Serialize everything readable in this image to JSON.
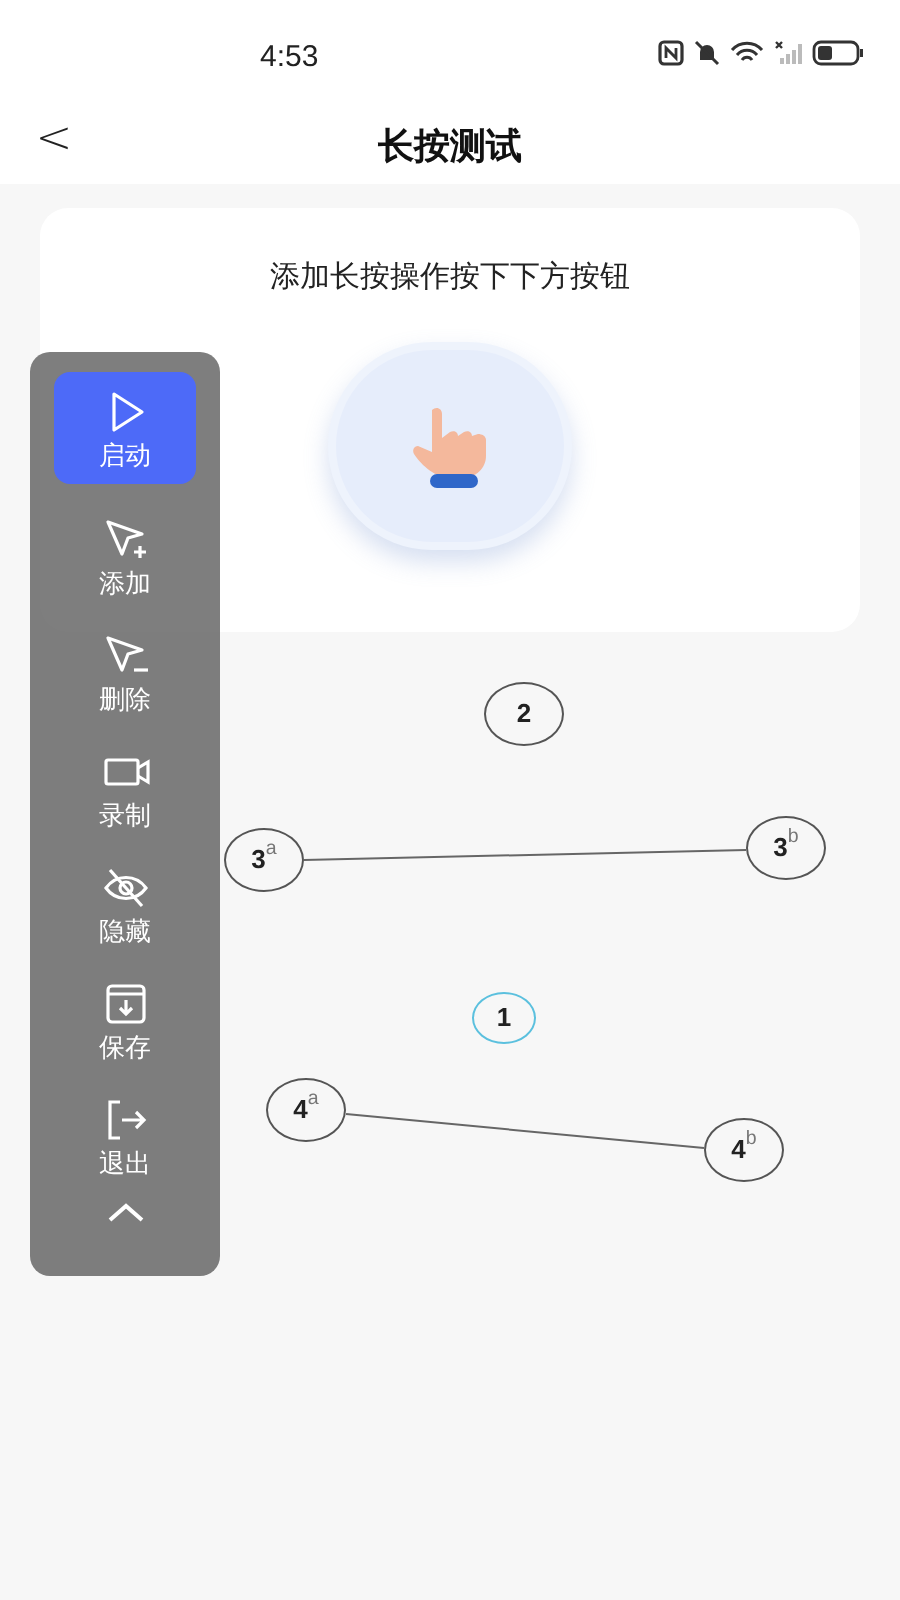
{
  "status_bar": {
    "time": "4:53"
  },
  "header": {
    "back": "<",
    "title": "长按测试"
  },
  "card": {
    "instruction": "添加长按操作按下下方按钮"
  },
  "toolbar": {
    "items": [
      {
        "kind": "play",
        "label": "启动",
        "selected": true
      },
      {
        "kind": "add",
        "label": "添加",
        "selected": false
      },
      {
        "kind": "remove",
        "label": "删除",
        "selected": false
      },
      {
        "kind": "record",
        "label": "录制",
        "selected": false
      },
      {
        "kind": "hide",
        "label": "隐藏",
        "selected": false
      },
      {
        "kind": "save",
        "label": "保存",
        "selected": false
      },
      {
        "kind": "exit",
        "label": "退出",
        "selected": false
      }
    ]
  },
  "markers": [
    {
      "label": "2",
      "selected": false
    },
    {
      "label": "3$^{a}$",
      "selected": false
    },
    {
      "label": "3$^{b}$",
      "selected": false
    },
    {
      "label": "1",
      "selected": true
    },
    {
      "label": "4$^{a}$",
      "selected": false
    },
    {
      "label": "4$^{b}$",
      "selected": false
    }
  ]
}
